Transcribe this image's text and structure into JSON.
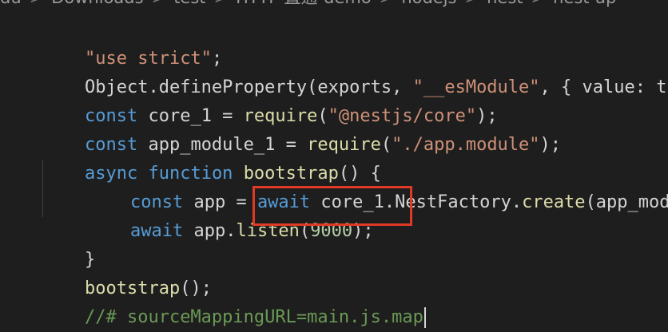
{
  "breadcrumb": [
    "du",
    "Downloads",
    "test",
    "HTTP 直通-demo",
    "nodejs",
    "nest",
    "nest-ap"
  ],
  "breadcrumb_separator": ">",
  "code": {
    "line1": {
      "str": "\"use strict\"",
      "rest": ";"
    },
    "line2": {
      "a": "Object.defineProperty(exports, ",
      "str": "\"__esModule\"",
      "b": ", { value: t"
    },
    "line3": {
      "kw": "const",
      "a": " core_1 = ",
      "fn": "require",
      "b": "(",
      "str": "\"@nestjs/core\"",
      "c": ");"
    },
    "line4": {
      "kw": "const",
      "a": " app_module_1 = ",
      "fn": "require",
      "b": "(",
      "str": "\"./app.module\"",
      "c": ");"
    },
    "line5": {
      "kw1": "async",
      "sp": " ",
      "kw2": "function",
      "sp2": " ",
      "fn": "bootstrap",
      "a": "() {"
    },
    "line6": {
      "kw": "const",
      "a": " app = ",
      "kw2": "await",
      "b": " core_1.NestFactory.",
      "fn": "create",
      "c": "(app_mod"
    },
    "line7": {
      "kw": "await",
      "a": " app.",
      "fn": "listen",
      "b": "(",
      "num": "9000",
      "c": ");"
    },
    "line8": {
      "a": "}"
    },
    "line9": {
      "fn": "bootstrap",
      "a": "();"
    },
    "line10": {
      "cmt": "//# sourceMappingURL=main.js.map"
    }
  },
  "colors": {
    "background": "#1e1e1e",
    "string": "#ce9178",
    "keyword": "#569cd6",
    "control_keyword": "#c586c0",
    "function": "#dcdcaa",
    "number": "#b5cea8",
    "comment": "#6a9955",
    "highlight": "#e03a24"
  }
}
